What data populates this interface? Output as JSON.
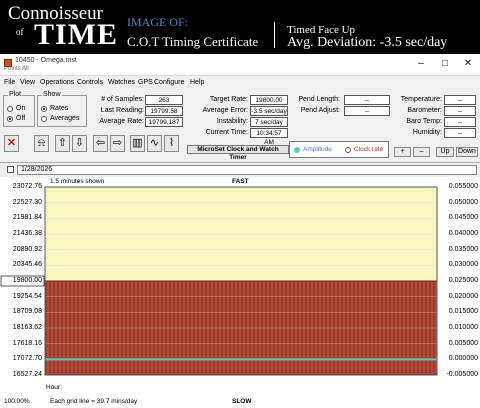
{
  "banner": {
    "brand_top": "Connoisseur",
    "brand_of": "of",
    "brand_time": "TIME",
    "image_of": "IMAGE OF:",
    "certificate": "C.O.T Timing Certificate",
    "position": "Timed Face Up",
    "avg_deviation": "Avg. Deviation: -3.5 sec/day"
  },
  "window": {
    "title": "10450 - Omega.mst",
    "subtitle": "Points All",
    "minimize": "–",
    "maximize": "□",
    "close": "✕"
  },
  "menu": [
    "File",
    "View",
    "Operations",
    "Controls",
    "Watches",
    "GPS",
    "Configure",
    "Help"
  ],
  "plot_group": {
    "title": "Plot",
    "on": "On",
    "off": "Off",
    "selected": "Off"
  },
  "show_group": {
    "title": "Show",
    "rates": "Rates",
    "averages": "Averages",
    "selected": "Rates"
  },
  "stats": {
    "samples_label": "# of Samples:",
    "samples": "263",
    "last_reading_label": "Last Reading:",
    "last_reading": "19799.58",
    "average_rate_label": "Average Rate:",
    "average_rate": "19799.187"
  },
  "target": {
    "target_rate_label": "Target Rate:",
    "target_rate": "19800.00",
    "average_error_label": "Average Error:",
    "average_error": "-3.5 sec/day",
    "instability_label": "Instability:",
    "instability": "7 sec/day",
    "current_time_label": "Current Time:",
    "current_time": "10:34:57 AM"
  },
  "pend": {
    "length_label": "Pend Length:",
    "length": "--",
    "adjust_label": "Pend Adjust:",
    "adjust": "--"
  },
  "env": {
    "temperature_label": "Temperature:",
    "temperature": "--",
    "barometer_label": "Barometer:",
    "barometer": "--",
    "baro_temp_label": "Baro Temp:",
    "baro_temp": "--",
    "humidity_label": "Humidity:",
    "humidity": "--"
  },
  "microset_label": "MicroSet Clock and Watch Timer",
  "legend": {
    "amplitude": "Amplitude",
    "clock_rate": "Clock rate"
  },
  "scale_buttons": {
    "plus": "+",
    "minus": "–",
    "up": "Up",
    "down": "Down"
  },
  "date_field": "1/28/2026",
  "chart": {
    "minutes_shown": "1.5 minutes shown",
    "fast": "FAST",
    "slow": "SLOW",
    "hour_label": "Hour:",
    "zoom": "100.00%",
    "grid_note": "Each grid line = 39.7 mins/day",
    "colors": {
      "fast_bg": "#f8f6c0",
      "slow_bg": "#a03a28",
      "slow_grid": "#c47a6a",
      "amp_line": "#5ec8c8"
    }
  },
  "chart_data": {
    "type": "line",
    "left_axis_ticks": [
      "23072.76",
      "22527.30",
      "21981.84",
      "21436.38",
      "20890.92",
      "20345.46",
      "19800.00",
      "19254.54",
      "18709.08",
      "18163.62",
      "17618.16",
      "17072.70",
      "16527.24"
    ],
    "right_axis_ticks": [
      "0.055000",
      "0.050000",
      "0.045000",
      "0.040000",
      "0.035000",
      "0.030000",
      "0.025000",
      "0.020000",
      "0.015000",
      "0.010000",
      "0.005000",
      "0.000000",
      "-0.005000"
    ],
    "target_rate": 19800.0,
    "series": [
      {
        "name": "Clock rate",
        "values": [
          19799.58,
          19799.58,
          19799.58,
          19799.58,
          19799.58,
          19799.58
        ]
      }
    ],
    "ylim": [
      16527.24,
      23072.76
    ]
  }
}
